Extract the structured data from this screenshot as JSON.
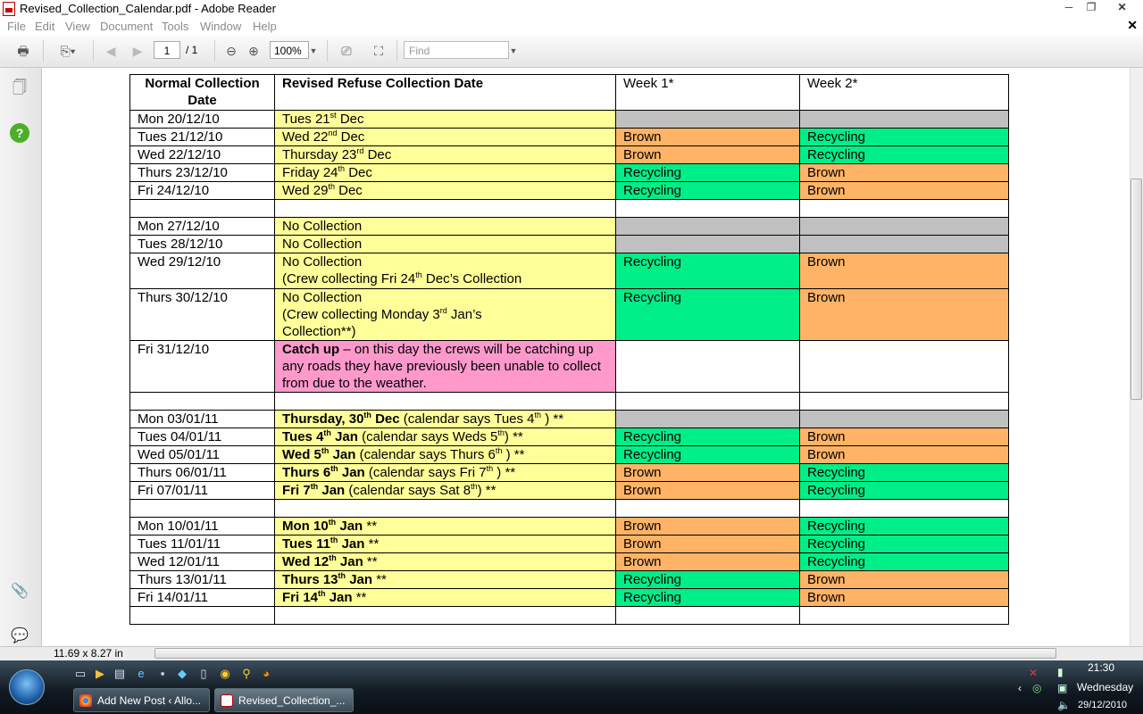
{
  "window": {
    "title": "Revised_Collection_Calendar.pdf - Adobe Reader",
    "minimize": "─",
    "maximize": "❐",
    "close": "✕"
  },
  "menu": [
    "File",
    "Edit",
    "View",
    "Document",
    "Tools",
    "Window",
    "Help"
  ],
  "menu_close": "✕",
  "toolbar": {
    "page_current": "1",
    "page_total": "/ 1",
    "zoom": "100%",
    "find_placeholder": "Find"
  },
  "table": {
    "headers": {
      "normal": "Normal Collection Date",
      "revised": "Revised Refuse Collection Date",
      "week1": "Week 1*",
      "week2": "Week 2*"
    },
    "r0": {
      "normal": "Mon 20/12/10",
      "rev_a": "Tues 21",
      "rev_sup": "st",
      "rev_b": " Dec"
    },
    "r1": {
      "normal": "Tues 21/12/10",
      "rev_a": "Wed 22",
      "rev_sup": "nd",
      "rev_b": " Dec",
      "w1": "Brown",
      "w2": "Recycling"
    },
    "r2": {
      "normal": "Wed 22/12/10",
      "rev_a": "Thursday 23",
      "rev_sup": "rd",
      "rev_b": " Dec",
      "w1": "Brown",
      "w2": "Recycling"
    },
    "r3": {
      "normal": "Thurs 23/12/10",
      "rev_a": "Friday 24",
      "rev_sup": "th",
      "rev_b": " Dec",
      "w1": "Recycling",
      "w2": "Brown"
    },
    "r4": {
      "normal": "Fri 24/12/10",
      "rev_a": "Wed 29",
      "rev_sup": "th",
      "rev_b": " Dec",
      "w1": "Recycling",
      "w2": "Brown"
    },
    "r5": {
      "normal": "Mon 27/12/10",
      "rev": "No Collection"
    },
    "r6": {
      "normal": "Tues 28/12/10",
      "rev": "No Collection"
    },
    "r7": {
      "normal": "Wed 29/12/10",
      "rev_l1": "No Collection",
      "rev_a": "(Crew collecting Fri 24",
      "rev_sup": "th",
      "rev_b": " Dec’s Collection",
      "w1": "Recycling",
      "w2": "Brown"
    },
    "r8": {
      "normal": "Thurs 30/12/10",
      "rev_l1": "No Collection",
      "rev_a": "(Crew collecting Monday 3",
      "rev_sup": "rd",
      "rev_b": " Jan’s",
      "rev_l3": "Collection**)",
      "w1": "Recycling",
      "w2": "Brown"
    },
    "r9": {
      "normal": "Fri 31/12/10",
      "rev_bold": "Catch up",
      "rev_rest": " – on this day the crews will be catching up any roads they have previously been unable to collect from due to the weather."
    },
    "r10": {
      "normal": "Mon 03/01/11",
      "rev_a": "Thursday, 30",
      "rev_sup": "th",
      "rev_b": " Dec",
      "note_a": " (calendar says Tues 4",
      "note_sup": "th",
      "note_b": " ) **"
    },
    "r11": {
      "normal": "Tues 04/01/11",
      "rev_a": "Tues 4",
      "rev_sup": "th",
      "rev_b": " Jan",
      "note_a": " (calendar says Weds 5",
      "note_sup": "th",
      "note_b": ") **",
      "w1": "Recycling",
      "w2": "Brown"
    },
    "r12": {
      "normal": "Wed 05/01/11",
      "rev_a": "Wed 5",
      "rev_sup": "th",
      "rev_b": " Jan",
      "note_a": " (calendar says Thurs 6",
      "note_sup": "th",
      "note_b": " ) **",
      "w1": "Recycling",
      "w2": "Brown"
    },
    "r13": {
      "normal": "Thurs 06/01/11",
      "rev_a": "Thurs 6",
      "rev_sup": "th",
      "rev_b": " Jan",
      "note_a": " (calendar says Fri 7",
      "note_sup": "th",
      "note_b": " ) **",
      "w1": "Brown",
      "w2": "Recycling"
    },
    "r14": {
      "normal": "Fri 07/01/11",
      "rev_a": "Fri 7",
      "rev_sup": "th",
      "rev_b": " Jan",
      "note_a": " (calendar says Sat 8",
      "note_sup": "th",
      "note_b": ") **",
      "w1": "Brown",
      "w2": "Recycling"
    },
    "r15": {
      "normal": "Mon 10/01/11",
      "rev_a": "Mon 10",
      "rev_sup": "th",
      "rev_b": " Jan",
      "note": " **",
      "w1": "Brown",
      "w2": "Recycling"
    },
    "r16": {
      "normal": "Tues 11/01/11",
      "rev_a": "Tues 11",
      "rev_sup": "th",
      "rev_b": " Jan",
      "note": "  **",
      "w1": "Brown",
      "w2": "Recycling"
    },
    "r17": {
      "normal": "Wed 12/01/11",
      "rev_a": "Wed 12",
      "rev_sup": "th",
      "rev_b": " Jan",
      "note": "  **",
      "w1": "Brown",
      "w2": "Recycling"
    },
    "r18": {
      "normal": "Thurs 13/01/11",
      "rev_a": "Thurs 13",
      "rev_sup": "th",
      "rev_b": " Jan",
      "note": "  **",
      "w1": "Recycling",
      "w2": "Brown"
    },
    "r19": {
      "normal": "Fri 14/01/11",
      "rev_a": "Fri 14",
      "rev_sup": "th",
      "rev_b": " Jan",
      "note": "  **",
      "w1": "Recycling",
      "w2": "Brown"
    }
  },
  "colors": {
    "yellow": "#ffff99",
    "green": "#00ee88",
    "orange": "#ffb366",
    "gray": "#c0c0c0",
    "pink": "#ff99cc"
  },
  "statusbar": {
    "page_size": "11.69 x 8.27 in"
  },
  "taskbar": {
    "tasks": [
      "Add New Post ‹ Allo...",
      "Revised_Collection_..."
    ],
    "time": "21:30",
    "day": "Wednesday",
    "date": "29/12/2010"
  }
}
